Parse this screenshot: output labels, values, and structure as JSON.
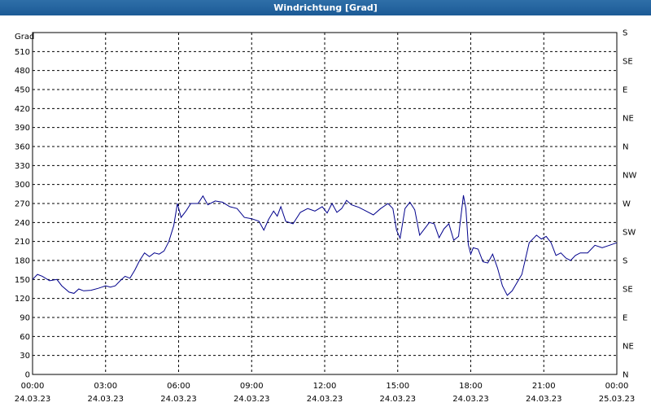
{
  "window": {
    "title": "Windrichtung [Grad]"
  },
  "chart_data": {
    "type": "line",
    "title": "Windrichtung [Grad]",
    "ylabel": "Grad",
    "ylim": [
      0,
      540
    ],
    "y_ticks": [
      0,
      30,
      60,
      90,
      120,
      150,
      180,
      210,
      240,
      270,
      300,
      330,
      360,
      390,
      420,
      450,
      480,
      510
    ],
    "y_right_ticks": [
      {
        "value": 0,
        "label": "N"
      },
      {
        "value": 45,
        "label": "NE"
      },
      {
        "value": 90,
        "label": "E"
      },
      {
        "value": 135,
        "label": "SE"
      },
      {
        "value": 180,
        "label": "S"
      },
      {
        "value": 225,
        "label": "SW"
      },
      {
        "value": 270,
        "label": "W"
      },
      {
        "value": 315,
        "label": "NW"
      },
      {
        "value": 360,
        "label": "N"
      },
      {
        "value": 405,
        "label": "NE"
      },
      {
        "value": 450,
        "label": "E"
      },
      {
        "value": 495,
        "label": "SE"
      },
      {
        "value": 540,
        "label": "S"
      }
    ],
    "x_ticks": [
      {
        "time": "00:00",
        "date": "24.03.23",
        "hours": 0
      },
      {
        "time": "03:00",
        "date": "24.03.23",
        "hours": 3
      },
      {
        "time": "06:00",
        "date": "24.03.23",
        "hours": 6
      },
      {
        "time": "09:00",
        "date": "24.03.23",
        "hours": 9
      },
      {
        "time": "12:00",
        "date": "24.03.23",
        "hours": 12
      },
      {
        "time": "15:00",
        "date": "24.03.23",
        "hours": 15
      },
      {
        "time": "18:00",
        "date": "24.03.23",
        "hours": 18
      },
      {
        "time": "21:00",
        "date": "24.03.23",
        "hours": 21
      },
      {
        "time": "00:00",
        "date": "25.03.23",
        "hours": 24
      }
    ],
    "xlim": [
      0,
      24
    ],
    "grid": true,
    "line_color": "#00008b",
    "series": [
      {
        "x": [
          0,
          0.2,
          0.4,
          0.7,
          1.0,
          1.2,
          1.5,
          1.7,
          1.9,
          2.1,
          2.4,
          2.7,
          3.0,
          3.2,
          3.4,
          3.6,
          3.8,
          4.0,
          4.2,
          4.4,
          4.6,
          4.8,
          5.0,
          5.2,
          5.4,
          5.6,
          5.8,
          5.95,
          6.1,
          6.3,
          6.5,
          6.8,
          7.0,
          7.2,
          7.5,
          7.8,
          8.1,
          8.4,
          8.7,
          9.0,
          9.3,
          9.5,
          9.7,
          9.9,
          10.05,
          10.2,
          10.4,
          10.7,
          11.0,
          11.3,
          11.6,
          11.9,
          12.1,
          12.3,
          12.5,
          12.7,
          12.9,
          13.1,
          13.4,
          13.7,
          14.0,
          14.3,
          14.6,
          14.8,
          14.95,
          15.1,
          15.3,
          15.5,
          15.7,
          15.9,
          16.1,
          16.3,
          16.5,
          16.7,
          16.9,
          17.1,
          17.3,
          17.5,
          17.7,
          17.8,
          17.9,
          18.0,
          18.1,
          18.3,
          18.5,
          18.7,
          18.9,
          19.1,
          19.3,
          19.5,
          19.7,
          19.9,
          20.1,
          20.4,
          20.7,
          20.9,
          21.1,
          21.3,
          21.5,
          21.7,
          21.9,
          22.1,
          22.3,
          22.5,
          22.8,
          23.1,
          23.4,
          23.7,
          24.0
        ],
        "y": [
          150,
          158,
          155,
          148,
          150,
          140,
          130,
          128,
          135,
          132,
          133,
          136,
          140,
          138,
          140,
          148,
          155,
          152,
          165,
          180,
          192,
          186,
          192,
          190,
          195,
          210,
          235,
          270,
          248,
          258,
          270,
          270,
          282,
          268,
          274,
          272,
          265,
          262,
          248,
          246,
          242,
          228,
          245,
          258,
          250,
          265,
          242,
          238,
          256,
          262,
          258,
          265,
          255,
          270,
          256,
          262,
          275,
          268,
          264,
          258,
          252,
          262,
          270,
          262,
          228,
          215,
          262,
          272,
          260,
          220,
          230,
          240,
          238,
          216,
          230,
          238,
          212,
          218,
          283,
          262,
          205,
          190,
          200,
          198,
          178,
          176,
          190,
          168,
          140,
          125,
          132,
          145,
          158,
          208,
          220,
          214,
          218,
          208,
          188,
          192,
          184,
          180,
          188,
          192,
          192,
          204,
          200,
          204,
          208
        ]
      }
    ]
  }
}
